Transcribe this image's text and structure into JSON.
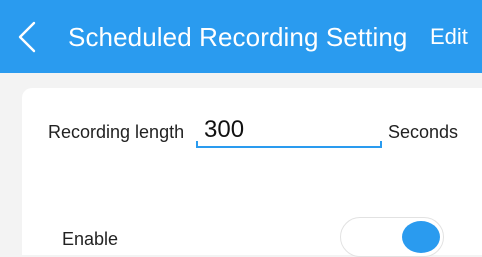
{
  "header": {
    "title": "Scheduled Recording Setting",
    "edit_label": "Edit",
    "back_icon": "chevron-left-icon"
  },
  "form": {
    "recording_length": {
      "label": "Recording length",
      "value": "300",
      "unit": "Seconds"
    },
    "enable": {
      "label": "Enable",
      "state": "on"
    }
  },
  "colors": {
    "accent": "#2a9bef",
    "background": "#f3f3f3",
    "card": "#ffffff"
  }
}
